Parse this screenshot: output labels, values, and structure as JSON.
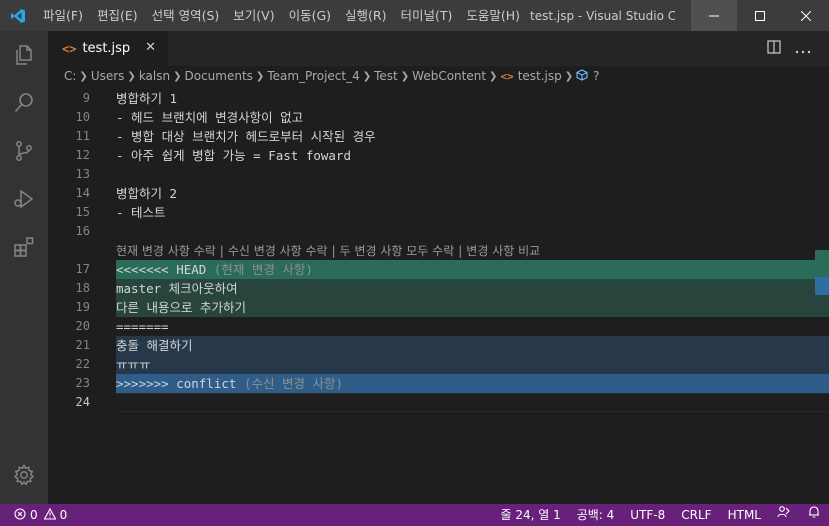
{
  "colors": {
    "accent": "#007acc",
    "status_bar": "#68217a",
    "current_change": "#2b6b5a",
    "incoming_change": "#2e5d8a"
  },
  "titlebar": {
    "menu": [
      "파일(F)",
      "편집(E)",
      "선택 영역(S)",
      "보기(V)",
      "이동(G)",
      "실행(R)",
      "터미널(T)",
      "도움말(H)"
    ],
    "window_title": "test.jsp - Visual Studio C..."
  },
  "activitybar": {
    "icons": [
      "explorer-icon",
      "search-icon",
      "source-control-icon",
      "run-debug-icon",
      "extensions-icon",
      "settings-gear-icon"
    ]
  },
  "tab": {
    "label": "test.jsp",
    "close": "✕"
  },
  "breadcrumb": {
    "items": [
      "C:",
      "Users",
      "kalsn",
      "Documents",
      "Team_Project_4",
      "Test",
      "WebContent"
    ],
    "file": "test.jsp",
    "symbol": "?"
  },
  "editor": {
    "lines": [
      {
        "num": "9",
        "text": "병합하기 1"
      },
      {
        "num": "10",
        "text": "- 헤드 브랜치에 변경사항이 없고"
      },
      {
        "num": "11",
        "text": "- 병합 대상 브랜치가 헤드로부터 시작된 경우"
      },
      {
        "num": "12",
        "text": "- 아주 쉽게 병합 가능 = Fast foward"
      },
      {
        "num": "13",
        "text": ""
      },
      {
        "num": "14",
        "text": "병합하기 2"
      },
      {
        "num": "15",
        "text": "- 테스트"
      },
      {
        "num": "16",
        "text": ""
      },
      {
        "num": "17",
        "text": "<<<<<<< HEAD",
        "suffix": " (현재 변경 사항)"
      },
      {
        "num": "18",
        "text": "master 체크아웃하여"
      },
      {
        "num": "19",
        "text": "다른 내용으로 추가하기"
      },
      {
        "num": "20",
        "text": "======="
      },
      {
        "num": "21",
        "text": "충돌 해결하기"
      },
      {
        "num": "22",
        "text": "ㅠㅠㅠ"
      },
      {
        "num": "23",
        "text": ">>>>>>> conflict",
        "suffix": " (수신 변경 사항)"
      },
      {
        "num": "24",
        "text": ""
      }
    ],
    "codelens": [
      "현재 변경 사항 수락",
      "수신 변경 사항 수락",
      "두 변경 사항 모두 수락",
      "변경 사항 비교"
    ]
  },
  "statusbar": {
    "errors": "0",
    "warnings": "0",
    "position": "줄 24, 열 1",
    "spaces": "공백: 4",
    "encoding": "UTF-8",
    "eol": "CRLF",
    "language": "HTML"
  }
}
